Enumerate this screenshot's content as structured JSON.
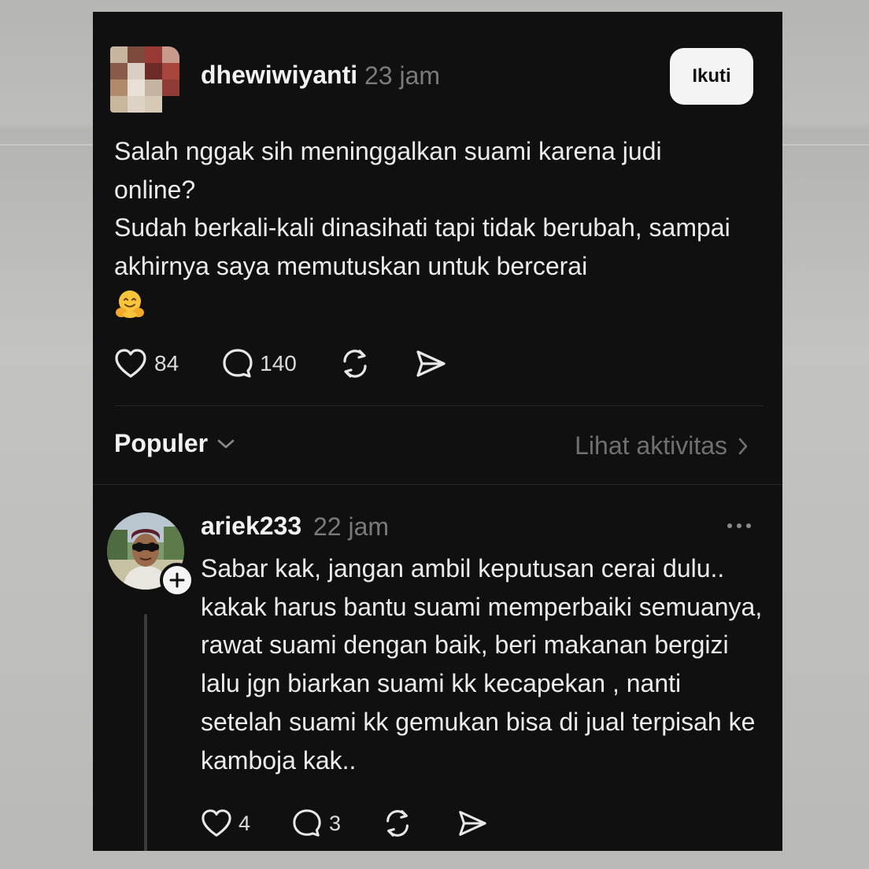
{
  "post": {
    "username": "dhewiwiyanti",
    "time": "23 jam",
    "follow_label": "Ikuti",
    "text_lines": [
      "Salah nggak sih meninggalkan suami karena judi online?",
      "Sudah berkali-kali dinasihati tapi tidak berubah, sampai akhirnya saya memutuskan untuk bercerai"
    ],
    "emoji": "hugging-face-emoji",
    "likes": "84",
    "comments": "140"
  },
  "replies_header": {
    "sort_label": "Populer",
    "activity_label": "Lihat aktivitas"
  },
  "reply": {
    "username": "ariek233",
    "time": "22 jam",
    "text": "Sabar kak, jangan ambil keputusan cerai dulu.. kakak harus bantu suami memperbaiki semuanya, rawat suami dengan baik, beri makanan bergizi lalu jgn biarkan suami kk kecapekan , nanti setelah suami kk gemukan bisa di jual terpisah ke kamboja kak..",
    "likes": "4",
    "comments": "3"
  },
  "icons": {
    "like": "heart-icon",
    "comment": "comment-bubble-icon",
    "repost": "repost-icon",
    "share": "send-icon",
    "chevron_down": "chevron-down-icon",
    "chevron_right": "chevron-right-icon",
    "more": "more-dots-icon",
    "add": "plus-icon"
  },
  "colors": {
    "card_background": "#101010",
    "primary_text": "#ececec",
    "muted_text": "#7a7a7a",
    "follow_button": "#f4f4f4"
  }
}
